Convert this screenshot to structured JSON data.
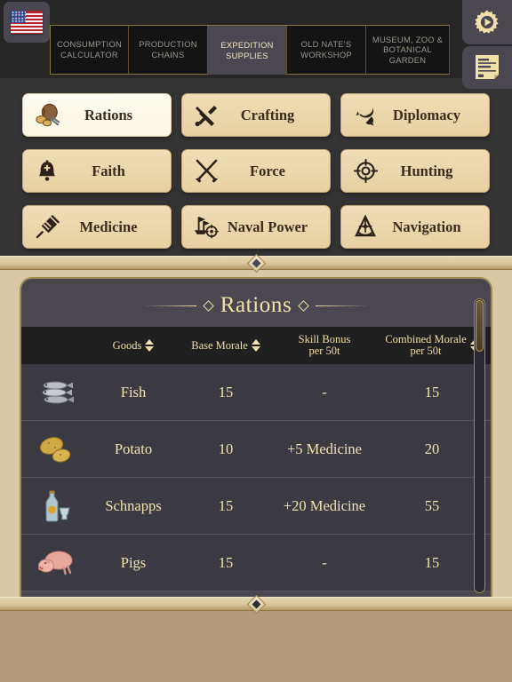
{
  "topbar": {
    "flag_icon": "us-flag-icon",
    "tabs": [
      {
        "label": "CONSUMPTION CALCULATOR",
        "active": false
      },
      {
        "label": "PRODUCTION CHAINS",
        "active": false
      },
      {
        "label": "EXPEDITION SUPPLIES",
        "active": true
      },
      {
        "label": "OLD NATE'S WORKSHOP",
        "active": false
      },
      {
        "label": "MUSEUM, ZOO & BOTANICAL GARDEN",
        "active": false
      }
    ],
    "rail": [
      {
        "icon": "gear-play-icon",
        "name": "settings-gear-button"
      },
      {
        "icon": "document-icon",
        "name": "notes-button"
      }
    ]
  },
  "categories": [
    {
      "label": "Rations",
      "icon": "rations-icon",
      "selected": true
    },
    {
      "label": "Crafting",
      "icon": "crafting-icon",
      "selected": false
    },
    {
      "label": "Diplomacy",
      "icon": "diplomacy-icon",
      "selected": false
    },
    {
      "label": "Faith",
      "icon": "faith-icon",
      "selected": false
    },
    {
      "label": "Force",
      "icon": "force-icon",
      "selected": false
    },
    {
      "label": "Hunting",
      "icon": "hunting-icon",
      "selected": false
    },
    {
      "label": "Medicine",
      "icon": "medicine-icon",
      "selected": false
    },
    {
      "label": "Naval Power",
      "icon": "naval-power-icon",
      "selected": false
    },
    {
      "label": "Navigation",
      "icon": "navigation-icon",
      "selected": false
    }
  ],
  "panel": {
    "title": "Rations",
    "columns": [
      {
        "label": "",
        "sortable": false
      },
      {
        "label": "Goods",
        "sortable": true
      },
      {
        "label": "Base Morale",
        "sortable": true
      },
      {
        "label": "Skill Bonus",
        "label2": "per 50t",
        "sortable": false
      },
      {
        "label": "Combined Morale",
        "label2": "per 50t",
        "sortable": true
      }
    ],
    "rows": [
      {
        "icon": "fish-icon",
        "goods": "Fish",
        "base_morale": "15",
        "skill_bonus": "-",
        "combined_morale": "15"
      },
      {
        "icon": "potato-icon",
        "goods": "Potato",
        "base_morale": "10",
        "skill_bonus": "+5 Medicine",
        "combined_morale": "20"
      },
      {
        "icon": "schnapps-icon",
        "goods": "Schnapps",
        "base_morale": "15",
        "skill_bonus": "+20 Medicine",
        "combined_morale": "55"
      },
      {
        "icon": "pigs-icon",
        "goods": "Pigs",
        "base_morale": "15",
        "skill_bonus": "-",
        "combined_morale": "15"
      }
    ]
  },
  "colors": {
    "panel_bg": "#4a4750",
    "accent_gold": "#efdfa8",
    "button_tan": "#e8d0a4",
    "frame_tan": "#d9c8a6",
    "dark": "#262626"
  }
}
